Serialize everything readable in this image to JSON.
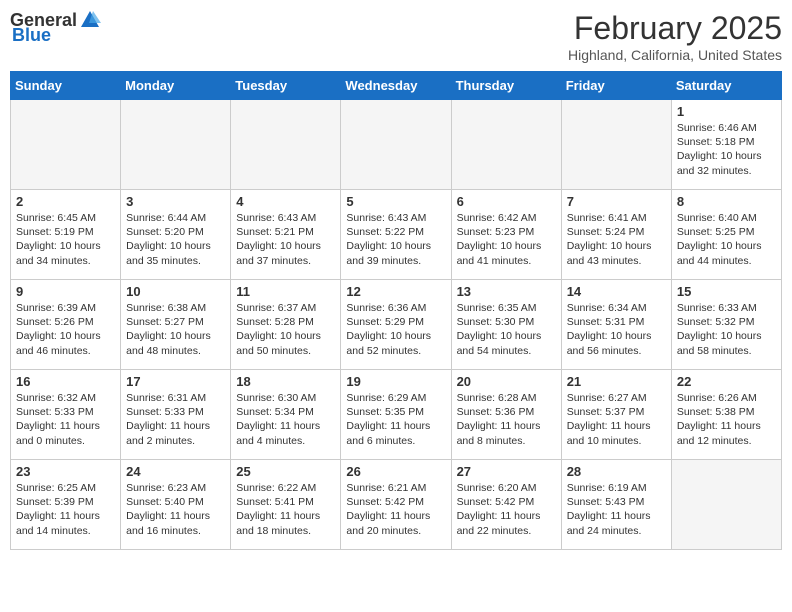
{
  "header": {
    "logo_general": "General",
    "logo_blue": "Blue",
    "month_title": "February 2025",
    "location": "Highland, California, United States"
  },
  "weekdays": [
    "Sunday",
    "Monday",
    "Tuesday",
    "Wednesday",
    "Thursday",
    "Friday",
    "Saturday"
  ],
  "weeks": [
    [
      {
        "day": "",
        "info": ""
      },
      {
        "day": "",
        "info": ""
      },
      {
        "day": "",
        "info": ""
      },
      {
        "day": "",
        "info": ""
      },
      {
        "day": "",
        "info": ""
      },
      {
        "day": "",
        "info": ""
      },
      {
        "day": "1",
        "info": "Sunrise: 6:46 AM\nSunset: 5:18 PM\nDaylight: 10 hours and 32 minutes."
      }
    ],
    [
      {
        "day": "2",
        "info": "Sunrise: 6:45 AM\nSunset: 5:19 PM\nDaylight: 10 hours and 34 minutes."
      },
      {
        "day": "3",
        "info": "Sunrise: 6:44 AM\nSunset: 5:20 PM\nDaylight: 10 hours and 35 minutes."
      },
      {
        "day": "4",
        "info": "Sunrise: 6:43 AM\nSunset: 5:21 PM\nDaylight: 10 hours and 37 minutes."
      },
      {
        "day": "5",
        "info": "Sunrise: 6:43 AM\nSunset: 5:22 PM\nDaylight: 10 hours and 39 minutes."
      },
      {
        "day": "6",
        "info": "Sunrise: 6:42 AM\nSunset: 5:23 PM\nDaylight: 10 hours and 41 minutes."
      },
      {
        "day": "7",
        "info": "Sunrise: 6:41 AM\nSunset: 5:24 PM\nDaylight: 10 hours and 43 minutes."
      },
      {
        "day": "8",
        "info": "Sunrise: 6:40 AM\nSunset: 5:25 PM\nDaylight: 10 hours and 44 minutes."
      }
    ],
    [
      {
        "day": "9",
        "info": "Sunrise: 6:39 AM\nSunset: 5:26 PM\nDaylight: 10 hours and 46 minutes."
      },
      {
        "day": "10",
        "info": "Sunrise: 6:38 AM\nSunset: 5:27 PM\nDaylight: 10 hours and 48 minutes."
      },
      {
        "day": "11",
        "info": "Sunrise: 6:37 AM\nSunset: 5:28 PM\nDaylight: 10 hours and 50 minutes."
      },
      {
        "day": "12",
        "info": "Sunrise: 6:36 AM\nSunset: 5:29 PM\nDaylight: 10 hours and 52 minutes."
      },
      {
        "day": "13",
        "info": "Sunrise: 6:35 AM\nSunset: 5:30 PM\nDaylight: 10 hours and 54 minutes."
      },
      {
        "day": "14",
        "info": "Sunrise: 6:34 AM\nSunset: 5:31 PM\nDaylight: 10 hours and 56 minutes."
      },
      {
        "day": "15",
        "info": "Sunrise: 6:33 AM\nSunset: 5:32 PM\nDaylight: 10 hours and 58 minutes."
      }
    ],
    [
      {
        "day": "16",
        "info": "Sunrise: 6:32 AM\nSunset: 5:33 PM\nDaylight: 11 hours and 0 minutes."
      },
      {
        "day": "17",
        "info": "Sunrise: 6:31 AM\nSunset: 5:33 PM\nDaylight: 11 hours and 2 minutes."
      },
      {
        "day": "18",
        "info": "Sunrise: 6:30 AM\nSunset: 5:34 PM\nDaylight: 11 hours and 4 minutes."
      },
      {
        "day": "19",
        "info": "Sunrise: 6:29 AM\nSunset: 5:35 PM\nDaylight: 11 hours and 6 minutes."
      },
      {
        "day": "20",
        "info": "Sunrise: 6:28 AM\nSunset: 5:36 PM\nDaylight: 11 hours and 8 minutes."
      },
      {
        "day": "21",
        "info": "Sunrise: 6:27 AM\nSunset: 5:37 PM\nDaylight: 11 hours and 10 minutes."
      },
      {
        "day": "22",
        "info": "Sunrise: 6:26 AM\nSunset: 5:38 PM\nDaylight: 11 hours and 12 minutes."
      }
    ],
    [
      {
        "day": "23",
        "info": "Sunrise: 6:25 AM\nSunset: 5:39 PM\nDaylight: 11 hours and 14 minutes."
      },
      {
        "day": "24",
        "info": "Sunrise: 6:23 AM\nSunset: 5:40 PM\nDaylight: 11 hours and 16 minutes."
      },
      {
        "day": "25",
        "info": "Sunrise: 6:22 AM\nSunset: 5:41 PM\nDaylight: 11 hours and 18 minutes."
      },
      {
        "day": "26",
        "info": "Sunrise: 6:21 AM\nSunset: 5:42 PM\nDaylight: 11 hours and 20 minutes."
      },
      {
        "day": "27",
        "info": "Sunrise: 6:20 AM\nSunset: 5:42 PM\nDaylight: 11 hours and 22 minutes."
      },
      {
        "day": "28",
        "info": "Sunrise: 6:19 AM\nSunset: 5:43 PM\nDaylight: 11 hours and 24 minutes."
      },
      {
        "day": "",
        "info": ""
      }
    ]
  ]
}
